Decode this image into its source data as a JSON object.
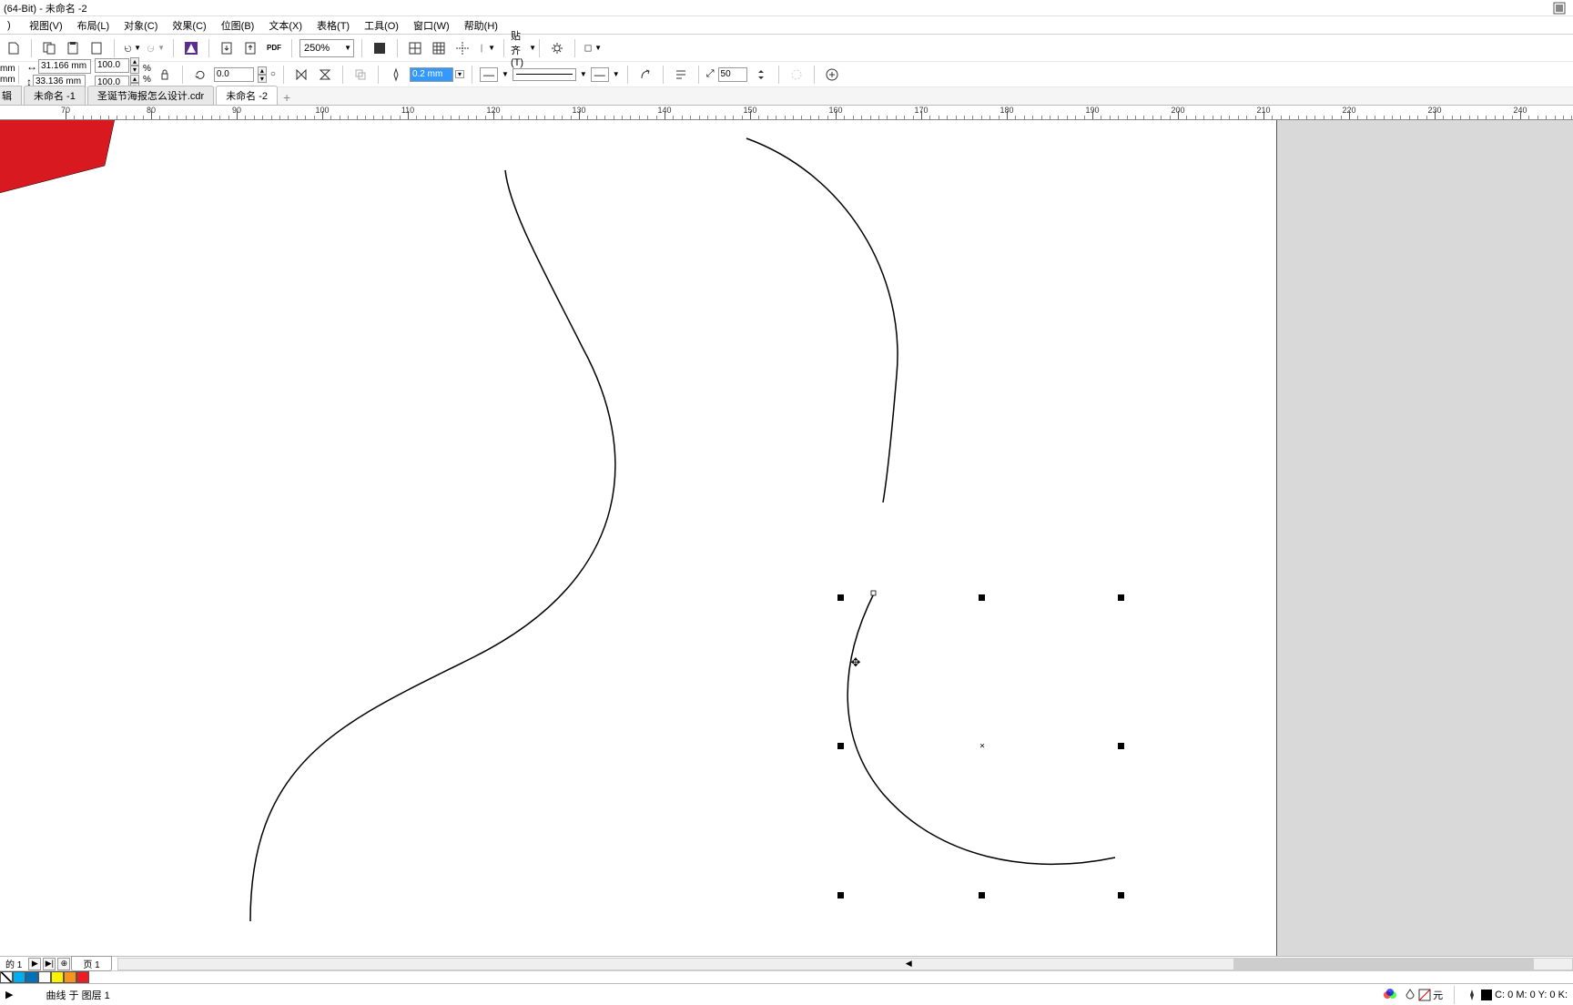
{
  "title": "(64-Bit) - 未命名 -2",
  "menu": {
    "view": "视图(V)",
    "layout": "布局(L)",
    "object": "对象(C)",
    "effect": "效果(C)",
    "bitmap": "位图(B)",
    "text": "文本(X)",
    "table": "表格(T)",
    "tools": "工具(O)",
    "window": "窗口(W)",
    "help": "帮助(H)"
  },
  "toolbar1": {
    "zoom": "250%",
    "snap": "贴齐(T)"
  },
  "prop": {
    "w": "31.166 mm",
    "h": "33.136 mm",
    "sx": "100.0",
    "sy": "100.0",
    "pct": "%",
    "rot": "0.0",
    "outline": "0.2 mm",
    "nudge": "50",
    "mm_unit": "mm"
  },
  "tabs": {
    "t0_prefix": "辑",
    "t1": "未命名 -1",
    "t2": "圣诞节海报怎么设计.cdr",
    "t3": "未命名 -2"
  },
  "ruler": {
    "marks": [
      70,
      80,
      90,
      100,
      110,
      120,
      130,
      140,
      150,
      160,
      170,
      180,
      190,
      200,
      210,
      220,
      230,
      240
    ]
  },
  "pagenav": {
    "page_of": "的 1",
    "page_label": "页 1"
  },
  "status": {
    "object_info": "曲线 于 图层 1",
    "fill_label": "元",
    "outline_info": "C: 0 M: 0 Y: 0 K:",
    "arrow": "▶"
  },
  "palette": [
    "#ffffff",
    "#00aeef",
    "#00a2e8",
    "#ffff00",
    "#fff200",
    "#ed1c24",
    "#c1272d"
  ]
}
